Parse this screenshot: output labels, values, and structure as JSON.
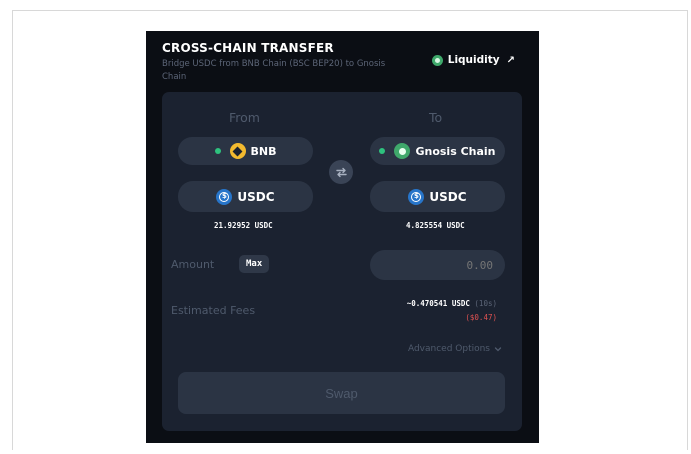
{
  "header": {
    "title": "CROSS-CHAIN TRANSFER",
    "subtitle": "Bridge USDC from BNB Chain (BSC BEP20) to Gnosis Chain",
    "liquidity_label": "Liquidity",
    "liquidity_arrow": "↗"
  },
  "from": {
    "heading": "From",
    "chain": "BNB",
    "token": "USDC",
    "balance": "21.92952 USDC"
  },
  "to": {
    "heading": "To",
    "chain": "Gnosis Chain",
    "token": "USDC",
    "balance": "4.825554 USDC"
  },
  "amount": {
    "label": "Amount",
    "max_label": "Max",
    "placeholder": "0.00"
  },
  "fees": {
    "label": "Estimated Fees",
    "value": "~0.470541 USDC",
    "time": "(10s)",
    "usd": "($0.47)"
  },
  "advanced_label": "Advanced Options",
  "swap_label": "Swap",
  "icons": {
    "liquidity": "gnosis-logo-icon",
    "swap_direction": "swap-arrows-icon",
    "chevron": "chevron-down-icon"
  },
  "colors": {
    "card_bg": "#0b0e14",
    "panel_bg": "#1b2230",
    "pill_bg": "#2b3444",
    "status_green": "#2ec27e",
    "fee_usd_red": "#e05252",
    "usdc_blue": "#2775ca",
    "bnb_yellow": "#f3ba2f"
  }
}
